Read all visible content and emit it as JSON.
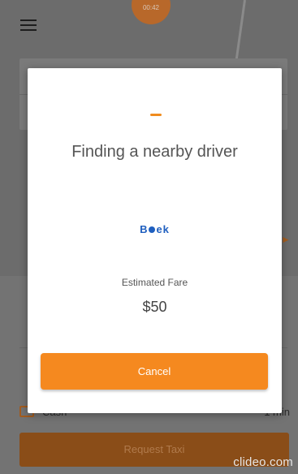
{
  "header": {
    "timer": "00:42"
  },
  "modal": {
    "title": "Finding a nearby driver",
    "logo_prefix": "B",
    "logo_suffix": "ek",
    "fare_label": "Estimated Fare",
    "fare_value": "$50",
    "cancel_label": "Cancel"
  },
  "bottom": {
    "payment_label": "Cash",
    "eta": "1 min",
    "request_label": "Request Taxi"
  },
  "watermark": "clideo.com",
  "colors": {
    "accent": "#f5891f",
    "logo": "#1f5fbf"
  }
}
